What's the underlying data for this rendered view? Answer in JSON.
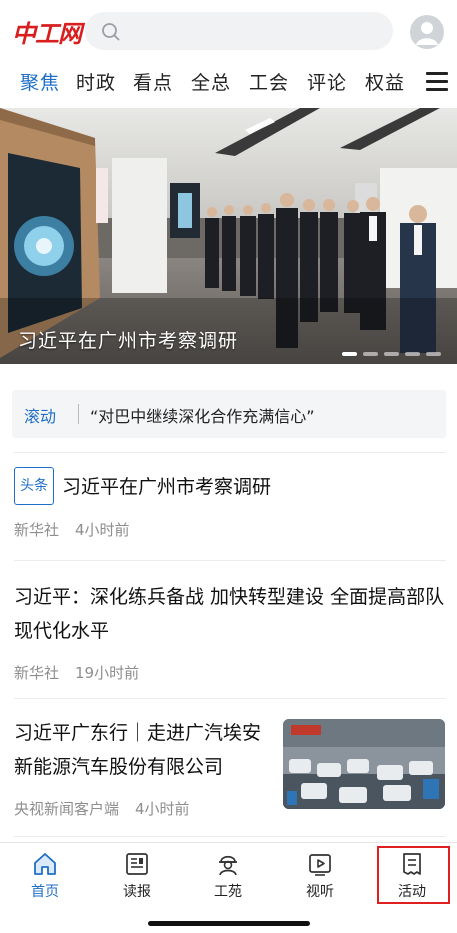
{
  "header": {
    "logo_text": "中工网",
    "search_placeholder": "",
    "avatar_icon": "user-avatar-icon"
  },
  "tabs": [
    {
      "label": "聚焦",
      "active": true
    },
    {
      "label": "时政"
    },
    {
      "label": "看点"
    },
    {
      "label": "全总"
    },
    {
      "label": "工会"
    },
    {
      "label": "评论"
    },
    {
      "label": "权益"
    }
  ],
  "banner": {
    "caption": "习近平在广州市考察调研",
    "slides_total": 5,
    "active_slide": 1
  },
  "ticker": {
    "label": "滚动",
    "text": "“对巴中继续深化合作充满信心”"
  },
  "news": [
    {
      "badge": "头条",
      "title": "习近平在广州市考察调研",
      "source": "新华社",
      "time": "4小时前"
    },
    {
      "title": "习近平：深化练兵备战 加快转型建设 全面提高部队现代化水平",
      "source": "新华社",
      "time": "19小时前"
    },
    {
      "title": "习近平广东行｜走进广汽埃安新能源汽车股份有限公司",
      "source": "央视新闻客户端",
      "time": "4小时前",
      "has_thumbnail": true
    }
  ],
  "bottom_nav": [
    {
      "label": "首页",
      "icon": "home-icon",
      "active": true
    },
    {
      "label": "读报",
      "icon": "newspaper-icon"
    },
    {
      "label": "工苑",
      "icon": "worker-icon"
    },
    {
      "label": "视听",
      "icon": "video-icon"
    },
    {
      "label": "活动",
      "icon": "activity-icon",
      "highlighted": true
    }
  ],
  "colors": {
    "accent": "#1f6fc8",
    "logo_red": "#d81e1e",
    "highlight_red": "#e02020"
  }
}
